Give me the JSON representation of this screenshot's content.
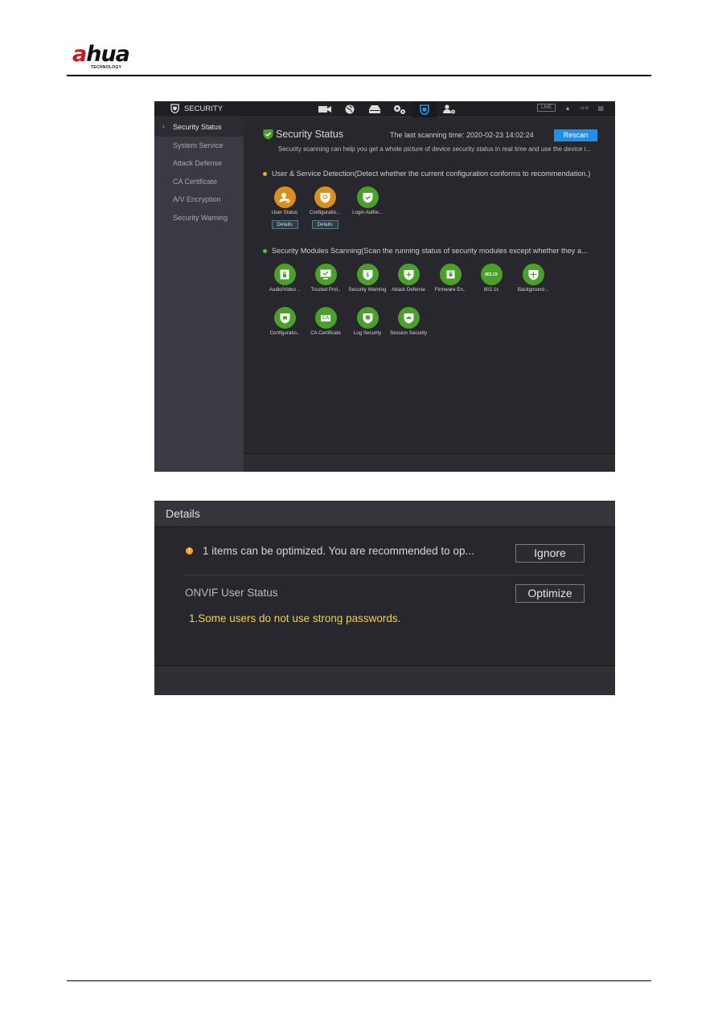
{
  "document": {
    "brand_prefix": "a",
    "brand_suffix": "hua",
    "brand_tagline": "TECHNOLOGY"
  },
  "security_screen": {
    "topbar": {
      "title": "SECURITY",
      "nav_icons": [
        "camera-icon",
        "network-globe-icon",
        "storage-icon",
        "system-settings-icon",
        "security-shield-icon",
        "account-icon"
      ],
      "active_nav": "security-shield-icon",
      "live_label": "LIVE"
    },
    "sidebar": {
      "items": [
        {
          "label": "Security Status",
          "active": true
        },
        {
          "label": "System Service",
          "active": false
        },
        {
          "label": "Attack Defense",
          "active": false
        },
        {
          "label": "CA Certificate",
          "active": false
        },
        {
          "label": "A/V Encryption",
          "active": false
        },
        {
          "label": "Security Warning",
          "active": false
        }
      ]
    },
    "main": {
      "title": "Security Status",
      "scan_time_label": "The last scanning time: 2020-02-23 14:02:24",
      "rescan_label": "Rescan",
      "description": "Security scanning can help you get a whole picture of device security status in real time and use the device i...",
      "user_service": {
        "heading": "User & Service Detection(Detect whether the current configuration conforms to recommendation.)",
        "status_color": "#f5a623",
        "tiles": [
          {
            "label": "User Status",
            "status": "warning",
            "details_label": "Details"
          },
          {
            "label": "Configuratio...",
            "status": "warning",
            "details_label": "Details"
          },
          {
            "label": "Login Authe...",
            "status": "ok"
          }
        ]
      },
      "modules": {
        "heading": "Security Modules Scanning(Scan the running status of security modules except whether they a...",
        "status_color": "#5fbf3a",
        "tiles": [
          {
            "label": "Audio/Video ..",
            "icon": "av-lock-icon"
          },
          {
            "label": "Trusted Prot..",
            "icon": "trusted-monitor-icon"
          },
          {
            "label": "Security Warning",
            "icon": "warning-shield-icon"
          },
          {
            "label": "Attack Defense",
            "icon": "defense-shield-icon"
          },
          {
            "label": "Firmware En..",
            "icon": "firmware-chip-icon"
          },
          {
            "label": "802.1x",
            "icon": "8021x-icon",
            "icon_text": "802.1X"
          },
          {
            "label": "Background ..",
            "icon": "background-shield-icon"
          },
          {
            "label": "Configuratio..",
            "icon": "config-shield-icon"
          },
          {
            "label": "CA Certificate",
            "icon": "ca-certificate-icon",
            "icon_text": "CA"
          },
          {
            "label": "Log Security",
            "icon": "log-shield-icon"
          },
          {
            "label": "Session Security",
            "icon": "session-shield-icon"
          }
        ]
      }
    }
  },
  "details_dialog": {
    "title": "Details",
    "summary": "1 items can be optimized. You are recommended to op...",
    "ignore_label": "Ignore",
    "item_label": "ONVIF User Status",
    "optimize_label": "Optimize",
    "warning": "1.Some users do not use strong passwords.",
    "warning_color": "#f3d23b"
  }
}
